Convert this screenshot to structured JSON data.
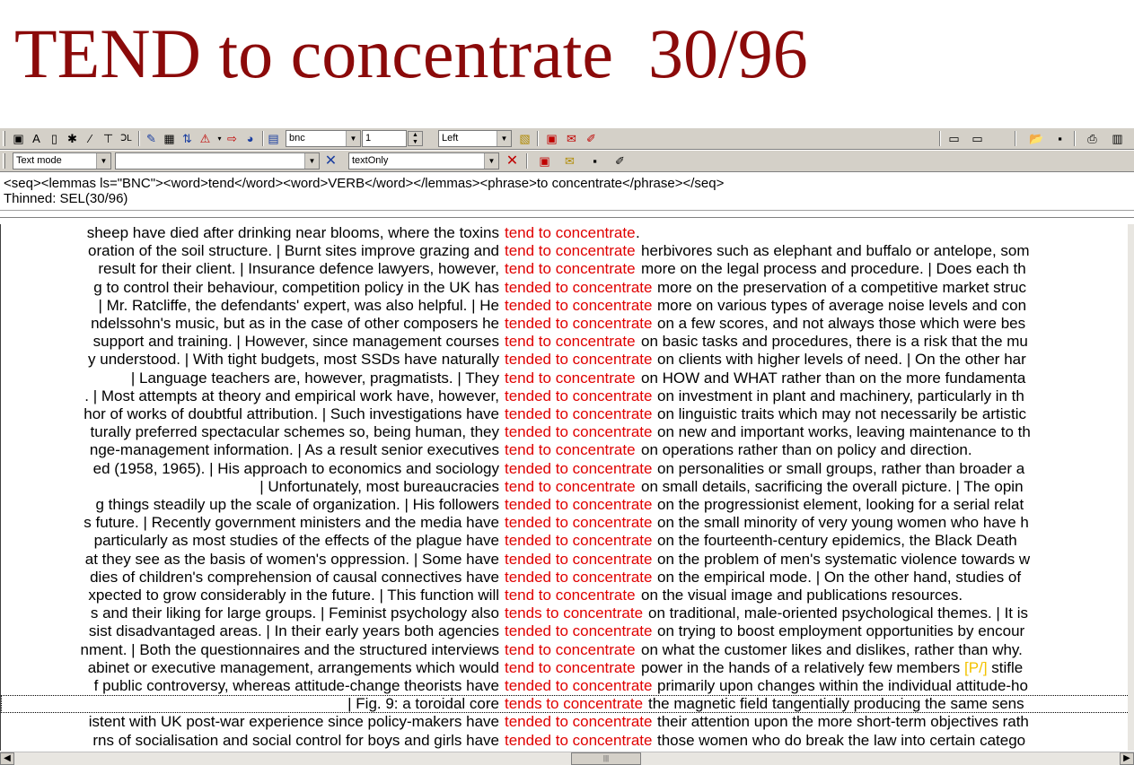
{
  "slide": {
    "title": "TEND to concentrate  30/96"
  },
  "toolbar1": {
    "corpus_value": "bnc",
    "number_value": "1",
    "align_value": "Left"
  },
  "toolbar2": {
    "mode_value": "Text mode",
    "filter_value": "",
    "display_value": "textOnly"
  },
  "query": {
    "line1": "<seq><lemmas ls=\"BNC\"><word>tend</word><word>VERB</word></lemmas><phrase>to concentrate</phrase></seq>",
    "line2": "Thinned: SEL(30/96)"
  },
  "concordance": [
    {
      "left": "sheep have died after drinking near blooms, where the toxins",
      "kw": "tend to concentrate",
      "right": "."
    },
    {
      "left": "oration of the soil structure. | Burnt sites improve grazing and",
      "kw": "tend to concentrate",
      "right": "herbivores such as elephant and buffalo or antelope, som"
    },
    {
      "left": "result for their client. | Insurance defence lawyers, however,",
      "kw": "tend to concentrate",
      "right": "more on the legal process and procedure. | Does each th"
    },
    {
      "left": "g to control their behaviour, competition policy in the UK has",
      "kw": "tended to concentrate",
      "right": "more on the preservation of a competitive market struc"
    },
    {
      "left": "| Mr. Ratcliffe, the defendants' expert, was also helpful. | He",
      "kw": "tended to concentrate",
      "right": "more on various types of average noise levels and con"
    },
    {
      "left": "ndelssohn's music, but as in the case of other composers he",
      "kw": "tended to concentrate",
      "right": "on a few scores, and not always those which were bes"
    },
    {
      "left": "support and training. | However, since management courses",
      "kw": "tend to concentrate",
      "right": "on basic tasks and procedures, there is a risk that the mu"
    },
    {
      "left": "y understood. | With tight budgets, most SSDs have naturally",
      "kw": "tended to concentrate",
      "right": "on clients with higher levels of need. | On the other har"
    },
    {
      "left": "| Language teachers are, however, pragmatists. | They",
      "kw": "tend to concentrate",
      "right": "on HOW and WHAT rather than on the more fundamenta"
    },
    {
      "left": ". | Most attempts at theory and empirical work have, however,",
      "kw": "tended to concentrate",
      "right": "on investment in plant and machinery, particularly in th"
    },
    {
      "left": "hor of works of doubtful attribution. | Such investigations have",
      "kw": "tended to concentrate",
      "right": "on linguistic traits which may not necessarily be artistic"
    },
    {
      "left": "turally preferred spectacular schemes so, being human, they",
      "kw": "tended to concentrate",
      "right": "on new and important works, leaving maintenance to th"
    },
    {
      "left": "nge-management information. | As a result senior executives",
      "kw": "tend to concentrate",
      "right": "on operations rather than on policy and direction."
    },
    {
      "left": "ed (1958, 1965). | His approach to economics and sociology",
      "kw": "tended to concentrate",
      "right": "on personalities or small groups, rather than broader a"
    },
    {
      "left": "| Unfortunately, most bureaucracies",
      "kw": "tend to concentrate",
      "right": "on small details, sacrificing the overall picture. | The opin"
    },
    {
      "left": "g things steadily up the scale of organization. | His followers",
      "kw": "tended to concentrate",
      "right": "on the progressionist element, looking for a serial relat"
    },
    {
      "left": "s future. | Recently government ministers and the media have",
      "kw": "tended to concentrate",
      "right": "on the small minority of very young women who have h"
    },
    {
      "left": "particularly as most studies of the effects of the plague have",
      "kw": "tended to concentrate",
      "right": "on the fourteenth-century epidemics, the Black Death"
    },
    {
      "left": "at they see as the basis of women's oppression. | Some have",
      "kw": "tended to concentrate",
      "right": "on the problem of men's systematic violence towards w"
    },
    {
      "left": "dies of children's comprehension of causal connectives have",
      "kw": "tended to concentrate",
      "right": "on the empirical mode. | On the other hand, studies of"
    },
    {
      "left": "xpected to grow considerably in the future. | This function will",
      "kw": "tend to concentrate",
      "right": "on the visual image and publications resources."
    },
    {
      "left": "s and their liking for large groups. | Feminist psychology also",
      "kw": "tends to concentrate",
      "right": "on traditional, male-oriented psychological themes. | It is"
    },
    {
      "left": "sist disadvantaged areas. | In their early years both agencies",
      "kw": "tended to concentrate",
      "right": "on trying to boost employment opportunities by encour"
    },
    {
      "left": "nment. | Both the questionnaires and the structured interviews",
      "kw": "tend to concentrate",
      "right": "on what the customer likes and dislikes, rather than why."
    },
    {
      "left": "abinet or executive management, arrangements which would",
      "kw": "tend to concentrate",
      "right": "power in the hands of a relatively few members",
      "tag": "[P/]",
      "after": "stifle"
    },
    {
      "left": "f public controversy, whereas attitude-change theorists have",
      "kw": "tended to concentrate",
      "right": "primarily upon changes within the individual attitude-ho"
    },
    {
      "left": "| Fig. 9: a toroidal core",
      "kw": "tends to concentrate",
      "right": "the magnetic field tangentially producing the same sens"
    },
    {
      "left": "istent with UK post-war experience since policy-makers have",
      "kw": "tended to concentrate",
      "right": "their attention upon the more short-term objectives rath"
    },
    {
      "left": "rns of socialisation and social control for boys and girls have",
      "kw": "tended to concentrate",
      "right": "those women who do break the law into certain catego"
    }
  ],
  "colors": {
    "title": "#8b0a0a",
    "keyword": "#e00000",
    "tag": "#f2c200"
  }
}
